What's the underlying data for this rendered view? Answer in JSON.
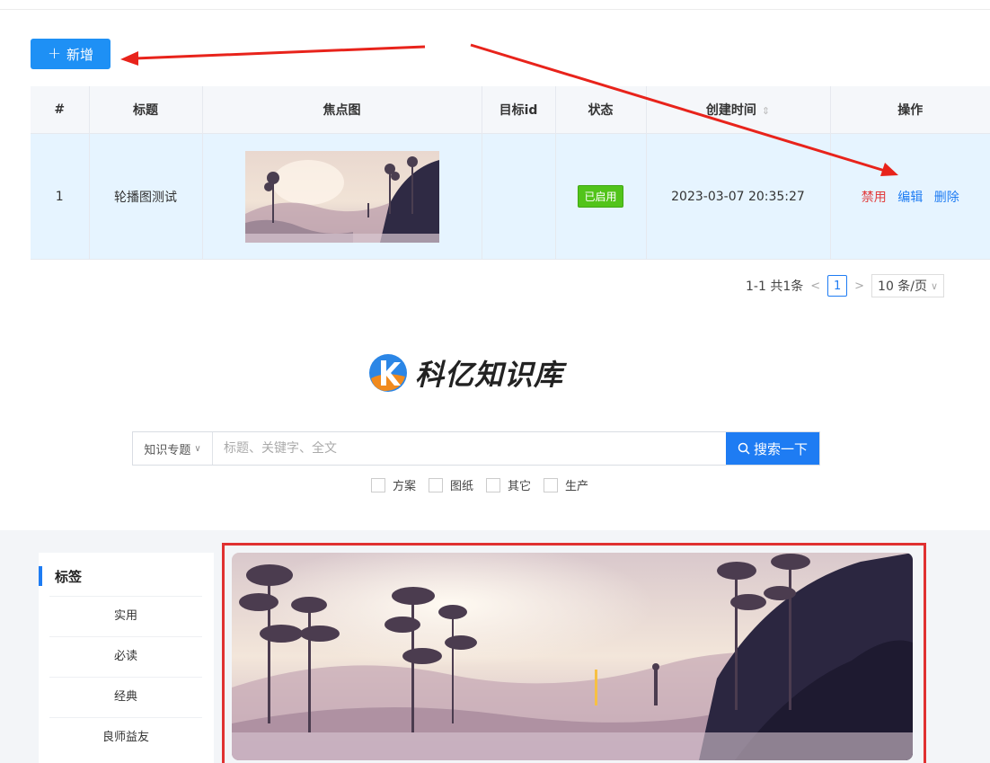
{
  "toolbar": {
    "add_label": "新增"
  },
  "table": {
    "headers": [
      "#",
      "标题",
      "焦点图",
      "目标id",
      "状态",
      "创建时间",
      "操作"
    ],
    "rows": [
      {
        "index": "1",
        "title": "轮播图测试",
        "target_id": "",
        "status": "已启用",
        "created": "2023-03-07 20:35:27",
        "actions": {
          "disable": "禁用",
          "edit": "编辑",
          "delete": "删除"
        }
      }
    ]
  },
  "pagination": {
    "summary": "1-1 共1条",
    "current_page": "1",
    "page_size": "10 条/页"
  },
  "portal": {
    "logo_text": "科亿知识库",
    "search": {
      "category": "知识专题",
      "placeholder": "标题、关键字、全文",
      "button": "搜索一下"
    },
    "filters": [
      "方案",
      "图纸",
      "其它",
      "生产"
    ],
    "tags": {
      "title": "标签",
      "items": [
        "实用",
        "必读",
        "经典",
        "良师益友"
      ]
    }
  },
  "colors": {
    "primary": "#1e7cf3",
    "danger": "#e03131",
    "success": "#52c41a"
  },
  "icons": {
    "add": "plus-icon",
    "search": "search-icon",
    "sort": "sort-icon",
    "dropdown": "chevron-down-icon"
  }
}
